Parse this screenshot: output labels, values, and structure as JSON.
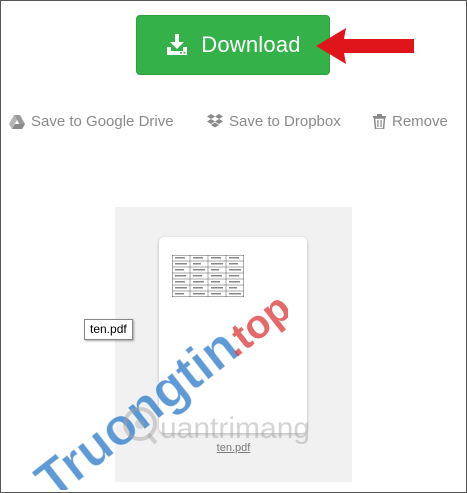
{
  "download": {
    "label": "Download",
    "icon": "download-icon",
    "color": "#34b249"
  },
  "annotation": {
    "arrow_color": "#e0141b"
  },
  "actions": [
    {
      "label": "Save to Google Drive",
      "icon": "google-drive-icon"
    },
    {
      "label": "Save to Dropbox",
      "icon": "dropbox-icon"
    },
    {
      "label": "Remove",
      "icon": "trash-icon"
    }
  ],
  "file": {
    "name_tooltip": "ten.pdf",
    "link_label": "ten.pdf"
  },
  "watermarks": {
    "primary": "Truongtin.top",
    "secondary": "uantrimang"
  }
}
